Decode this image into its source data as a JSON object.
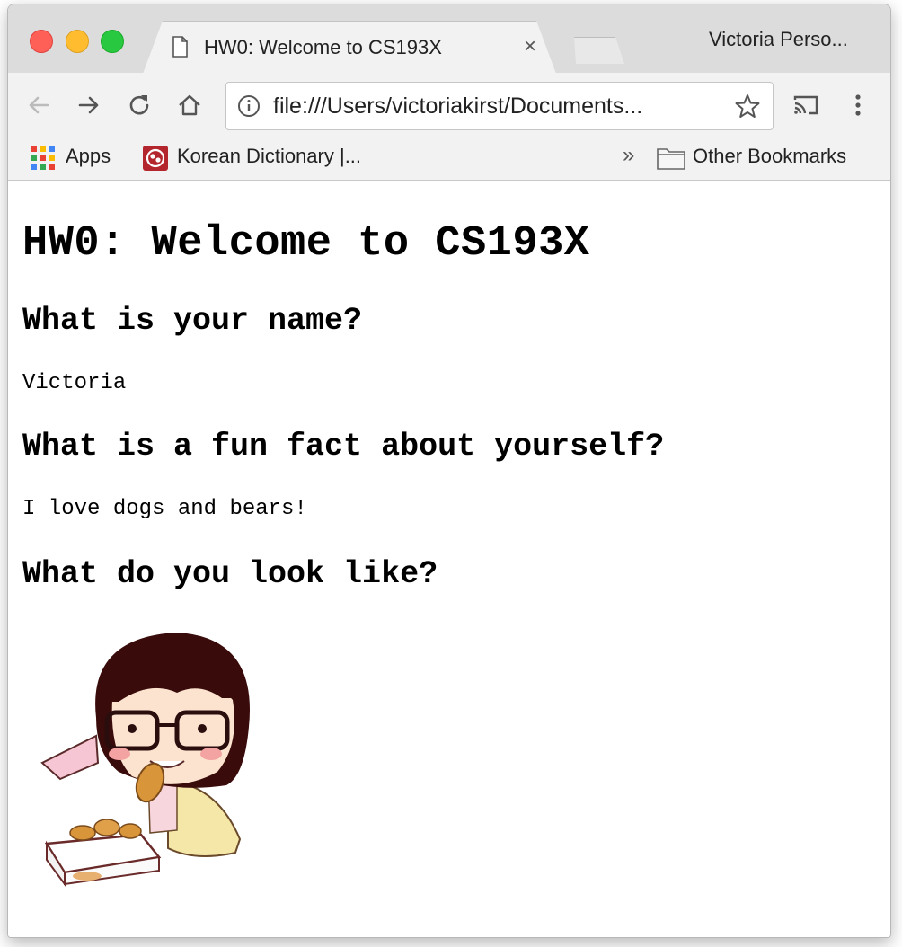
{
  "browser": {
    "tab": {
      "title": "HW0: Welcome to CS193X",
      "close_glyph": "×"
    },
    "profile_name": "Victoria Perso...",
    "toolbar": {
      "url": "file:///Users/victoriakirst/Documents..."
    },
    "bookmarks": {
      "apps_label": "Apps",
      "korean_dictionary_label": "Korean Dictionary |...",
      "overflow_glyph": "»",
      "other_bookmarks_label": "Other Bookmarks"
    }
  },
  "page": {
    "heading": "HW0: Welcome to CS193X",
    "name_question": "What is your name?",
    "name_answer": "Victoria",
    "fact_question": "What is a fun fact about yourself?",
    "fact_answer": "I love dogs and bears!",
    "look_question": "What do you look like?"
  },
  "colors": {
    "close": "#fe5f57",
    "minimize": "#febc2e",
    "zoom": "#28c840",
    "chrome_bg": "#f2f2f2",
    "tabstrip_bg": "#dcdcdc"
  }
}
